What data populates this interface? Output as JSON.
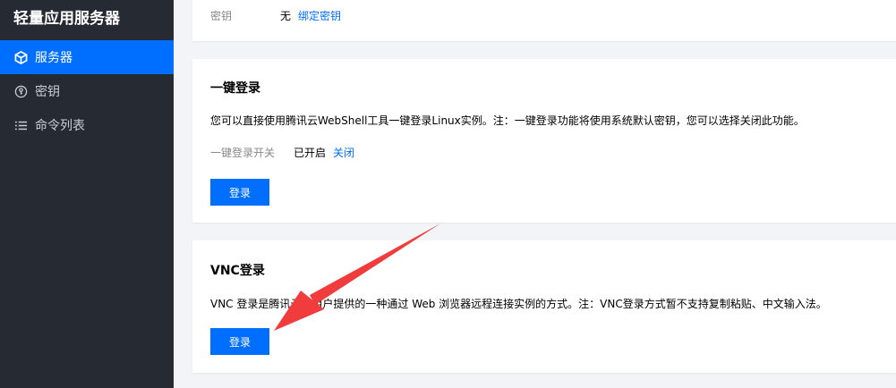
{
  "app_title": "轻量应用服务器",
  "sidebar": {
    "items": [
      {
        "label": "服务器",
        "icon": "cube-icon",
        "active": true
      },
      {
        "label": "密钥",
        "icon": "key-icon",
        "active": false
      },
      {
        "label": "命令列表",
        "icon": "list-icon",
        "active": false
      }
    ]
  },
  "key_card": {
    "label": "密钥",
    "value": "无",
    "link": "绑定密钥"
  },
  "one_click_card": {
    "title": "一键登录",
    "description": "您可以直接使用腾讯云WebShell工具一键登录Linux实例。注：一键登录功能将使用系统默认密钥，您可以选择关闭此功能。",
    "switch_label": "一键登录开关",
    "switch_status": "已开启",
    "switch_link": "关闭",
    "button": "登录"
  },
  "vnc_card": {
    "title": "VNC登录",
    "description": "VNC 登录是腾讯云为用户提供的一种通过 Web 浏览器远程连接实例的方式。注：VNC登录方式暂不支持复制粘贴、中文输入法。",
    "button": "登录"
  },
  "colors": {
    "sidebar_bg": "#262b33",
    "accent": "#006eff",
    "arrow": "#f03c3c"
  }
}
